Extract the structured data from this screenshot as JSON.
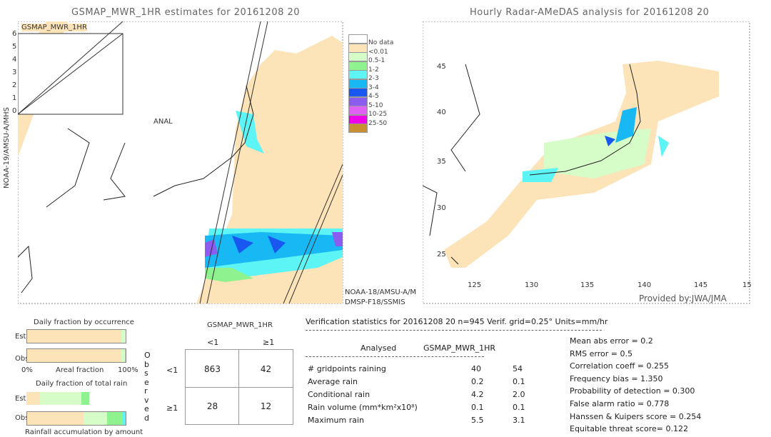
{
  "left_map": {
    "title": "GSMAP_MWR_1HR estimates for 20161208 20",
    "inset_label": "GSMAP_MWR_1HR",
    "inset_xlabel": "ANAL",
    "inset_ticks": [
      "0",
      "1",
      "2",
      "3",
      "4",
      "5",
      "6"
    ],
    "sensor_left": "NOAA-19/AMSU-A/MHS",
    "sensor_bottom_1": "NOAA-18/AMSU-A/M",
    "sensor_bottom_2": "DMSP-F18/SSMIS"
  },
  "legend": {
    "items": [
      {
        "label": "No data",
        "color": "#ffffff"
      },
      {
        "label": "<0.01",
        "color": "#fde4b8"
      },
      {
        "label": "0.5-1",
        "color": "#d6fcc8"
      },
      {
        "label": "1-2",
        "color": "#8ef28e"
      },
      {
        "label": "2-3",
        "color": "#5cf4f4"
      },
      {
        "label": "3-4",
        "color": "#18b8f4"
      },
      {
        "label": "4-5",
        "color": "#1858f0"
      },
      {
        "label": "5-10",
        "color": "#8c5cf0"
      },
      {
        "label": "10-25",
        "color": "#e060f4"
      },
      {
        "label": "25-50",
        "color": "#f000e8"
      },
      {
        "label": "",
        "color": "#c89030"
      }
    ]
  },
  "right_map": {
    "title": "Hourly Radar-AMeDAS analysis for 20161208 20",
    "lat_ticks": [
      "45",
      "40",
      "35",
      "30",
      "25"
    ],
    "lon_ticks": [
      "125",
      "130",
      "135",
      "140",
      "145",
      "15"
    ],
    "credit": "Provided by:JWA/JMA"
  },
  "occurrence": {
    "title": "Daily fraction by occurrence",
    "est_label": "Est",
    "obs_label": "Obs",
    "axis_left": "0%",
    "axis_mid": "Areal fraction",
    "axis_right": "100%",
    "est_fractions": [
      0.958,
      0.042
    ],
    "obs_fractions": [
      0.958,
      0.035,
      0.007
    ]
  },
  "total_rain": {
    "title": "Daily fraction of total rain",
    "est_label": "Est",
    "obs_label": "Obs",
    "footer": "Rainfall accumulation by amount",
    "est_fractions": [
      0.14,
      0.42,
      0.08
    ],
    "obs_fractions": [
      0.57,
      0.24,
      0.16,
      0.03
    ]
  },
  "contingency": {
    "title": "GSMAP_MWR_1HR",
    "col_headers": [
      "<1",
      "≥1"
    ],
    "row_headers": [
      "<1",
      "≥1"
    ],
    "observed_label": "Observed",
    "cells": [
      [
        "863",
        "42"
      ],
      [
        "28",
        "12"
      ]
    ]
  },
  "stats": {
    "header": "Verification statistics for 20161208 20   n=945   Verif. grid=0.25°   Units=mm/hr",
    "col_analysed": "Analysed",
    "col_est": "GSMAP_MWR_1HR",
    "rows": [
      {
        "label": "# gridpoints raining",
        "a": "40",
        "b": "54"
      },
      {
        "label": "Average rain",
        "a": "0.2",
        "b": "0.1"
      },
      {
        "label": "Conditional rain",
        "a": "4.2",
        "b": "2.0"
      },
      {
        "label": "Rain volume (mm*km²x10⁸)",
        "a": "0.1",
        "b": "0.1"
      },
      {
        "label": "Maximum rain",
        "a": "5.5",
        "b": "3.1"
      }
    ],
    "scores": [
      "Mean abs error = 0.2",
      "RMS error = 0.5",
      "Correlation coeff = 0.255",
      "Frequency bias = 1.350",
      "Probability of detection = 0.300",
      "False alarm ratio = 0.778",
      "Hanssen & Kuipers score = 0.254",
      "Equitable threat score= 0.122"
    ]
  }
}
